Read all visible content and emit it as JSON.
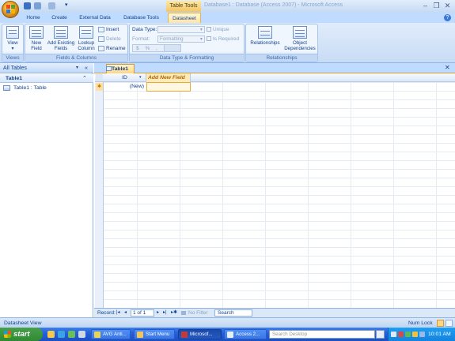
{
  "window": {
    "title": "Database1 : Database (Access 2007) - Microsoft Access",
    "context_tab_header": "Table Tools",
    "controls": [
      "–",
      "❐",
      "✕"
    ]
  },
  "ribbon_tabs": [
    "Home",
    "Create",
    "External Data",
    "Database Tools",
    "Datasheet"
  ],
  "active_tab": "Datasheet",
  "groups": {
    "views": {
      "label": "Views",
      "view_button": "View"
    },
    "fields_columns": {
      "label": "Fields & Columns",
      "new_field": [
        "New",
        "Field"
      ],
      "add_existing": [
        "Add Existing",
        "Fields"
      ],
      "lookup": [
        "Lookup",
        "Column"
      ],
      "insert": "Insert",
      "delete": "Delete",
      "rename": "Rename"
    },
    "data_type_formatting": {
      "label": "Data Type & Formatting",
      "data_type_label": "Data Type:",
      "data_type_value": "",
      "format_label": "Format:",
      "format_value": "Formatting",
      "unique": "Unique",
      "is_required": "Is Required",
      "currency_symbol": "$",
      "percent_symbol": "%"
    },
    "relationships": {
      "label": "Relationships",
      "relationships_btn": "Relationships",
      "object_deps": [
        "Object",
        "Dependencies"
      ]
    }
  },
  "nav_pane": {
    "header": "All Tables",
    "group": "Table1",
    "item": "Table1 : Table"
  },
  "document": {
    "tab": "Table1",
    "columns": {
      "id": "ID",
      "add": "Add New Field"
    },
    "new_row_value": "(New)"
  },
  "record_nav": {
    "label": "Record:",
    "position": "1 of 1",
    "filter": "No Filter",
    "search": "Search"
  },
  "status": {
    "left": "Datasheet View",
    "num_lock": "Num Lock"
  },
  "taskbar": {
    "start": "start",
    "tasks": [
      "AVG Anti...",
      "Start Menu",
      "Microsof...",
      "Access 2..."
    ],
    "search_placeholder": "Search Desktop",
    "clock": "10:01 AM"
  },
  "colors": {
    "ribbon_blue": "#bfdbff",
    "accent_orange": "#f3c561",
    "taskbar_blue": "#245ed8",
    "start_green": "#3c963f"
  }
}
